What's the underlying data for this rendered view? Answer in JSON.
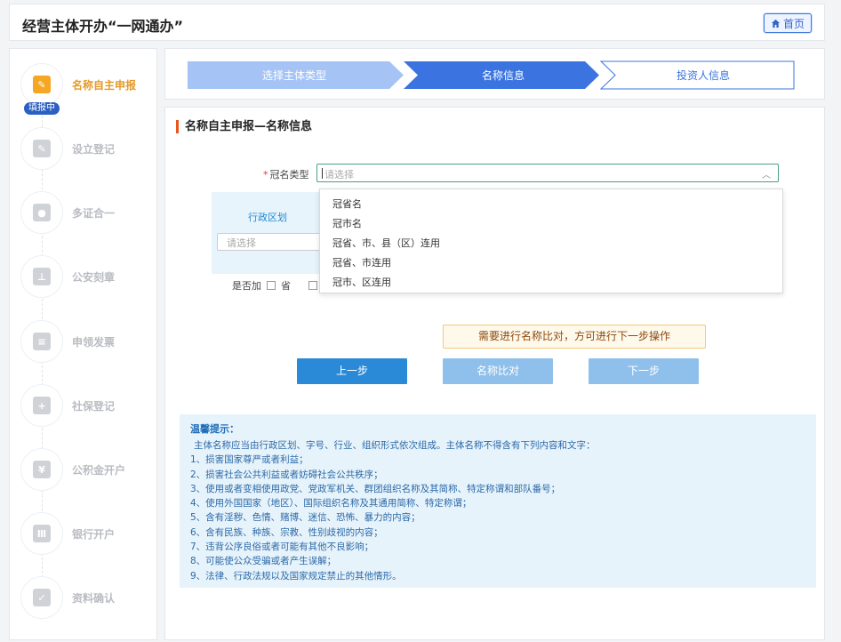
{
  "header": {
    "title": "经营主体开办“一网通办”",
    "home_label": "首页"
  },
  "sidebar": {
    "badge": "填报中",
    "steps": [
      {
        "label": "名称自主申报",
        "icon": "edit-form-icon"
      },
      {
        "label": "设立登记",
        "icon": "edit-doc-icon"
      },
      {
        "label": "多证合一",
        "icon": "license-icon"
      },
      {
        "label": "公安刻章",
        "icon": "stamp-icon"
      },
      {
        "label": "申领发票",
        "icon": "invoice-icon"
      },
      {
        "label": "社保登记",
        "icon": "social-security-icon"
      },
      {
        "label": "公积金开户",
        "icon": "housing-fund-icon"
      },
      {
        "label": "银行开户",
        "icon": "bank-icon"
      },
      {
        "label": "资料确认",
        "icon": "document-check-icon"
      }
    ]
  },
  "progress": {
    "steps": [
      "选择主体类型",
      "名称信息",
      "投资人信息"
    ],
    "current": 2
  },
  "form": {
    "section_title": "名称自主申报—名称信息",
    "crown_type_label": "冠名类型",
    "crown_type_placeholder": "请选择",
    "region_label": "行政区划",
    "region_placeholder": "请选择",
    "add_label": "是否加",
    "province_label": "省",
    "options": [
      "冠省名",
      "冠市名",
      "冠省、市、县（区）连用",
      "冠省、市连用",
      "冠市、区连用"
    ]
  },
  "tip": "需要进行名称比对，方可进行下一步操作",
  "buttons": {
    "prev": "上一步",
    "compare": "名称比对",
    "next": "下一步"
  },
  "hint": {
    "title": "温馨提示：",
    "items": [
      "主体名称应当由行政区划、字号、行业、组织形式依次组成。主体名称不得含有下列内容和文字：",
      "1、损害国家尊严或者利益；",
      "2、损害社会公共利益或者妨碍社会公共秩序；",
      "3、使用或者变相使用政党、党政军机关、群团组织名称及其简称、特定称谓和部队番号；",
      "4、使用外国国家（地区）、国际组织名称及其通用简称、特定称谓；",
      "5、含有淫秽、色情、赌博、迷信、恐怖、暴力的内容；",
      "6、含有民族、种族、宗教、性别歧视的内容；",
      "7、违背公序良俗或者可能有其他不良影响；",
      "8、可能使公众受骗或者产生误解；",
      "9、法律、行政法规以及国家规定禁止的其他情形。"
    ]
  },
  "colors": {
    "primary": "#2b8ad8",
    "disabled": "#8fc0ec",
    "step_done": "#a5c4f5",
    "step_current": "#3b74e0",
    "active_orange": "#f5a623"
  }
}
